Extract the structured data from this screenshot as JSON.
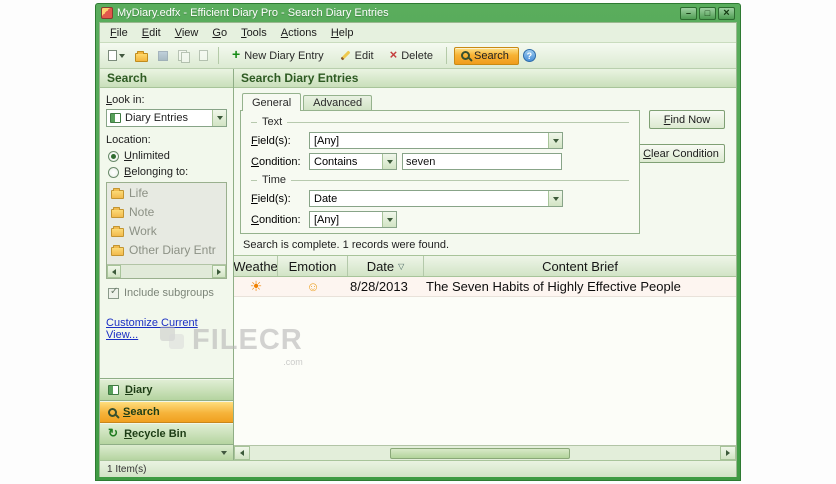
{
  "window": {
    "title": "MyDiary.edfx - Efficient Diary Pro - Search Diary Entries"
  },
  "menu": [
    "File",
    "Edit",
    "View",
    "Go",
    "Tools",
    "Actions",
    "Help"
  ],
  "toolbar": {
    "new_entry": "New Diary Entry",
    "edit": "Edit",
    "delete": "Delete",
    "search": "Search"
  },
  "sidebar": {
    "header": "Search",
    "look_in_label": "Look in:",
    "look_in_value": "Diary Entries",
    "location_label": "Location:",
    "unlimited": "Unlimited",
    "belonging_to": "Belonging to:",
    "folders": [
      "Life",
      "Note",
      "Work",
      "Other Diary Entr"
    ],
    "include_subgroups": "Include subgroups",
    "customize_view": "Customize Current View...",
    "nav_diary": "Diary",
    "nav_search": "Search",
    "nav_recycle": "Recycle Bin"
  },
  "search_form": {
    "header": "Search Diary Entries",
    "tab_general": "General",
    "tab_advanced": "Advanced",
    "text_group": {
      "title": "Text",
      "fields_label": "Field(s):",
      "fields_value": "[Any]",
      "condition_label": "Condition:",
      "condition_value": "Contains",
      "keyword": "seven"
    },
    "time_group": {
      "title": "Time",
      "fields_label": "Field(s):",
      "fields_value": "Date",
      "condition_label": "Condition:",
      "condition_value": "[Any]"
    },
    "find_now": "Find Now",
    "clear_condition": "Clear Condition",
    "result_status": "Search is complete. 1 records were found."
  },
  "results": {
    "columns": [
      "Weathe",
      "Emotion",
      "Date",
      "Content Brief"
    ],
    "rows": [
      {
        "weather_icon": "sun",
        "emotion_icon": "smiley",
        "date": "8/28/2013",
        "content": "The Seven Habits of Highly Effective People"
      }
    ]
  },
  "icons": {
    "sun": "☀",
    "smiley": "☺"
  },
  "watermark": {
    "text": "FILECR",
    "domain": ".com"
  },
  "statusbar": {
    "text": "1 Item(s)"
  }
}
